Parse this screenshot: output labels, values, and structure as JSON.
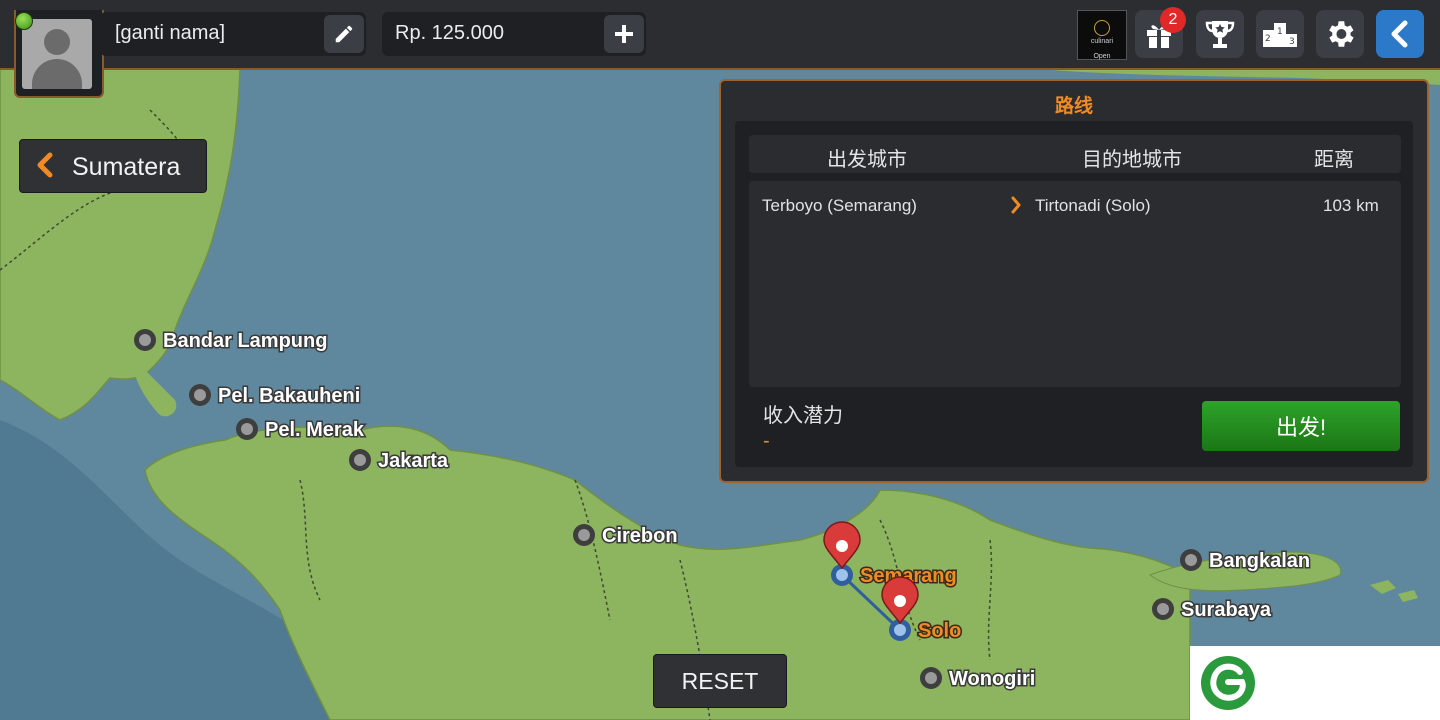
{
  "profile": {
    "name": "[ganti nama]"
  },
  "wallet": {
    "money": "Rp. 125.000"
  },
  "toolbar": {
    "gift_badge": "2",
    "promo_text": "culinari",
    "promo_sub": "Open"
  },
  "region_button": {
    "label": "Sumatera"
  },
  "route_panel": {
    "title": "路线",
    "col_origin": "出发城市",
    "col_destination": "目的地城市",
    "col_distance": "距离",
    "route": {
      "origin": "Terboyo (Semarang)",
      "destination": "Tirtonadi (Solo)",
      "distance": "103 km"
    },
    "income_label": "收入潜力",
    "income_value": "-",
    "go_label": "出发!"
  },
  "reset_button": {
    "label": "RESET"
  },
  "map": {
    "cities": [
      "Bandar Lampung",
      "Pel. Bakauheni",
      "Pel. Merak",
      "Jakarta",
      "Cirebon",
      "Bangkalan",
      "Surabaya",
      "Wonogiri"
    ],
    "selected_cities": [
      "Semarang",
      "Solo"
    ]
  },
  "colors": {
    "accent": "#f08a24",
    "go_button": "#2ea32a",
    "back_button": "#2d79c9",
    "land": "#8db45e",
    "sea": "#5f889f",
    "pin": "#d93a3a"
  }
}
